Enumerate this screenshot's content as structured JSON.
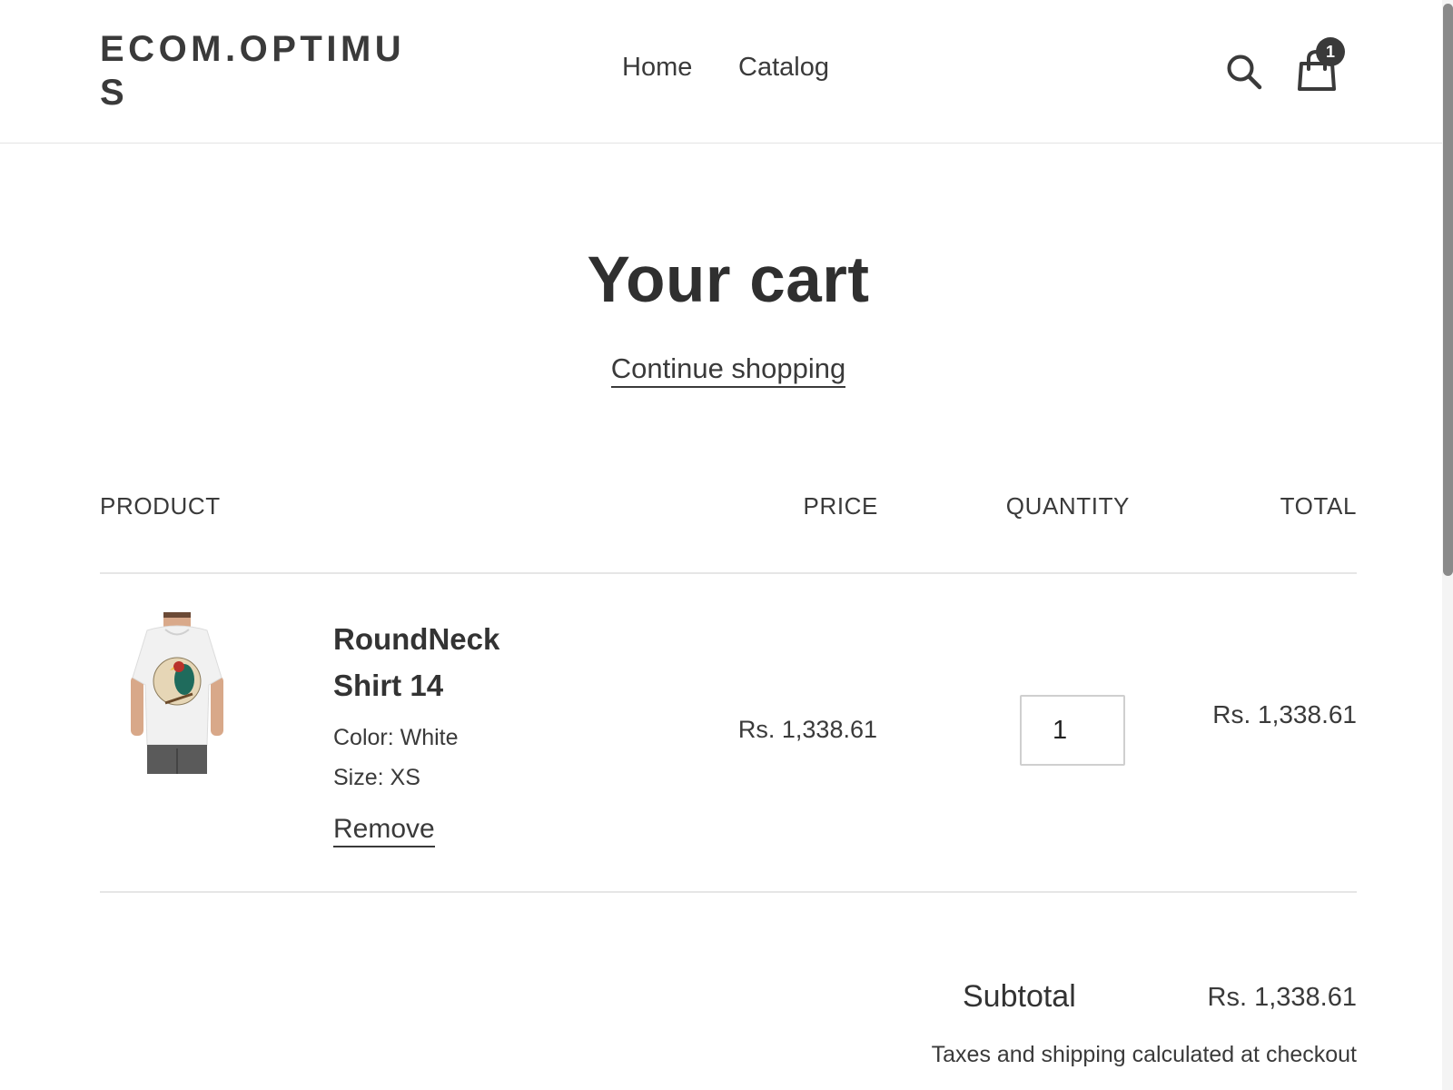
{
  "header": {
    "logo": "ECOM.OPTIMUS",
    "nav": {
      "home": "Home",
      "catalog": "Catalog"
    },
    "cart_count": "1"
  },
  "page": {
    "title": "Your cart",
    "continue_label": "Continue shopping"
  },
  "table": {
    "headers": {
      "product": "PRODUCT",
      "price": "PRICE",
      "quantity": "QUANTITY",
      "total": "TOTAL"
    },
    "item": {
      "title": "RoundNeck Shirt 14",
      "color": "Color: White",
      "size": "Size: XS",
      "remove_label": "Remove",
      "price": "Rs. 1,338.61",
      "quantity": "1",
      "total": "Rs. 1,338.61"
    }
  },
  "summary": {
    "subtotal_label": "Subtotal",
    "subtotal_value": "Rs. 1,338.61",
    "tax_note": "Taxes and shipping calculated at checkout"
  },
  "icons": {
    "search": "search-icon",
    "cart": "shopping-bag-icon"
  },
  "colors": {
    "text": "#3a3a3a",
    "badge": "#3a3a3a",
    "divider": "#e6e6e6"
  }
}
